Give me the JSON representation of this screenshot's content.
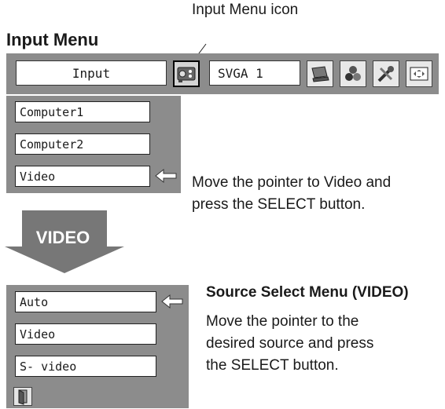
{
  "annotations": {
    "icon_callout": "Input Menu icon",
    "menu_title": "Input Menu"
  },
  "menubar": {
    "input_label": "Input",
    "resolution_label": "SVGA 1",
    "icons": [
      "input-menu-icon",
      "laptop-icon",
      "color-balls-icon",
      "tools-icon",
      "screen-icon"
    ]
  },
  "input_menu": {
    "items": [
      "Computer1",
      "Computer2",
      "Video"
    ],
    "selected": "Video"
  },
  "instructions": {
    "step1": [
      "Move the pointer to Video and",
      "press the SELECT button."
    ],
    "arrow_label": "VIDEO"
  },
  "source_select": {
    "title": "Source Select Menu (VIDEO)",
    "items": [
      "Auto",
      "Video",
      "S- video"
    ],
    "selected": "Auto",
    "instructions": [
      "Move the pointer to the",
      "desired source and press",
      "the SELECT button."
    ]
  },
  "colors": {
    "panel_gray": "#8c8c8c",
    "arrow_gray": "#777777"
  }
}
